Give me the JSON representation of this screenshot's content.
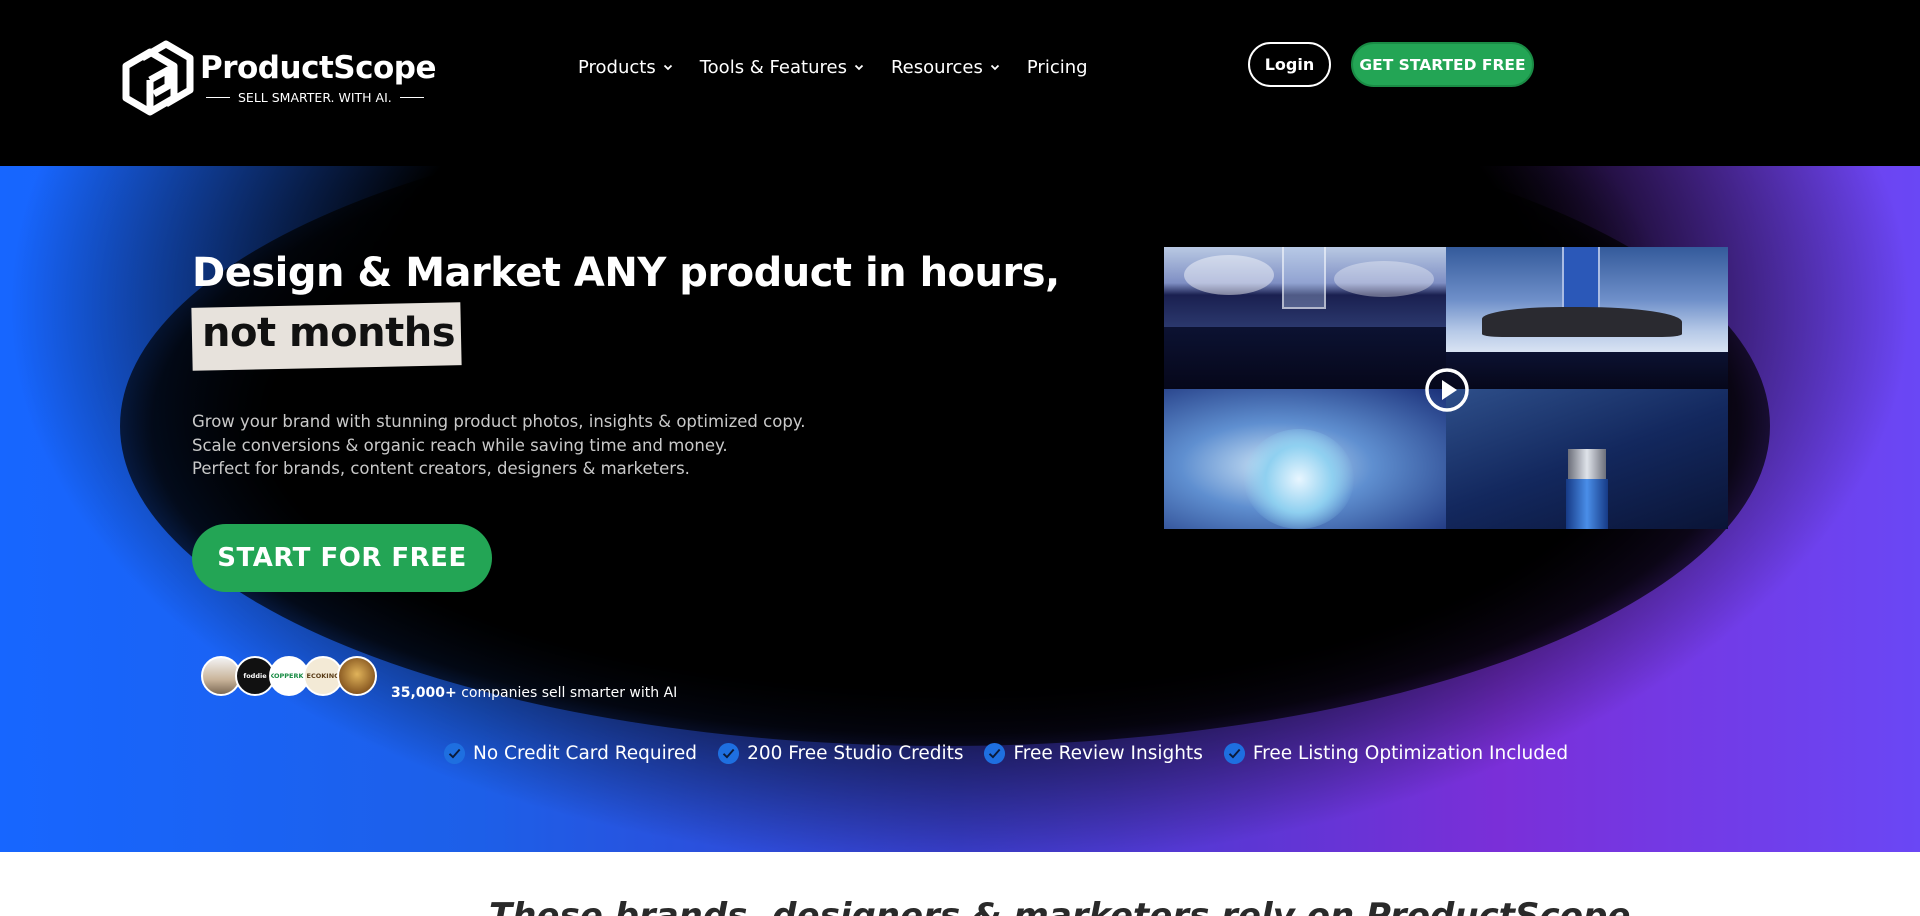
{
  "brand": {
    "name": "ProductScope",
    "tagline": "SELL SMARTER. WITH AI."
  },
  "nav": {
    "items": [
      {
        "label": "Products",
        "has_dropdown": true
      },
      {
        "label": "Tools & Features",
        "has_dropdown": true
      },
      {
        "label": "Resources",
        "has_dropdown": true
      },
      {
        "label": "Pricing",
        "has_dropdown": false
      }
    ],
    "login_label": "Login",
    "cta_label": "GET STARTED FREE"
  },
  "hero": {
    "headline": "Design & Market ANY product in hours,",
    "headline_highlight": "not months",
    "sub_lines": [
      "Grow your brand with stunning product photos, insights & optimized copy.",
      "Scale conversions & organic reach while saving time and money.",
      "Perfect for brands, content creators, designers & marketers."
    ],
    "start_label": "START FOR FREE",
    "proof_count": "35,000+",
    "proof_text": " companies sell smarter with AI",
    "avatars": [
      {
        "label": ""
      },
      {
        "label": "foddie"
      },
      {
        "label": "KOPPERKO"
      },
      {
        "label": "ECOKING"
      },
      {
        "label": ""
      }
    ],
    "checks": [
      "No Credit Card Required",
      "200 Free Studio Credits",
      "Free Review Insights",
      "Free Listing Optimization Included"
    ]
  },
  "band": {
    "text": "These brands, designers & marketers rely on ProductScope"
  },
  "colors": {
    "accent_green": "#23a555",
    "check_blue": "#1e6fe0",
    "hero_blue": "#1766ff",
    "hero_purple": "#7a2fd8"
  },
  "icons": {
    "logo": "productscope-logo-icon",
    "dropdown": "chevron-down-icon",
    "check": "check-circle-icon",
    "play": "play-icon"
  }
}
